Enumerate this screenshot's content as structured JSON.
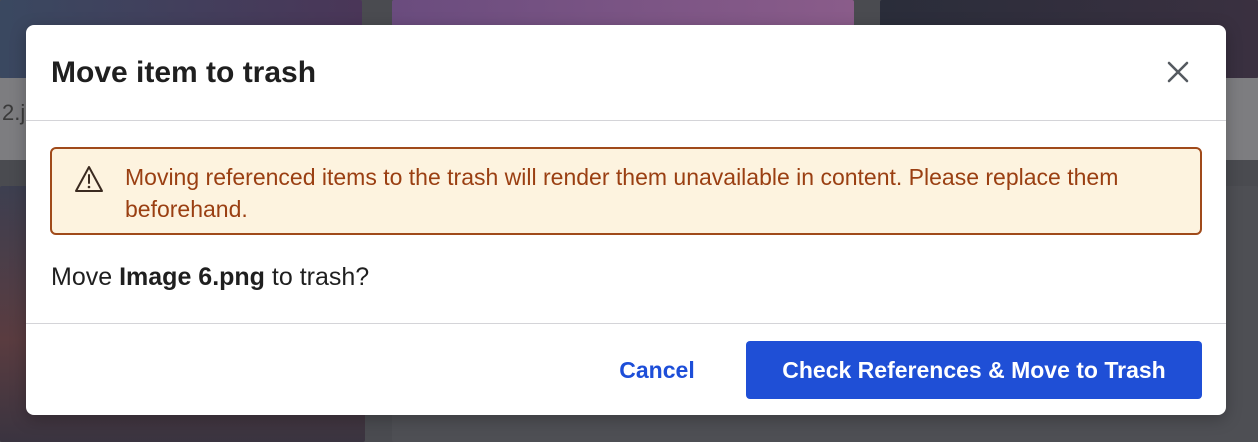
{
  "background": {
    "partial_filename": "2.j"
  },
  "dialog": {
    "title": "Move item to trash",
    "close_icon": "close-icon",
    "warning": {
      "icon": "warning-triangle-icon",
      "text": "Moving referenced items to the trash will render them unavailable in content. Please replace them beforehand."
    },
    "question": {
      "prefix": "Move ",
      "filename": "Image 6.png",
      "suffix": " to trash?"
    },
    "buttons": {
      "cancel_label": "Cancel",
      "confirm_label": "Check References & Move to Trash"
    }
  },
  "colors": {
    "primary": "#1f4fd6",
    "link": "#1d4ed8",
    "warning_bg": "#fdf3df",
    "warning_border": "#a04a1a",
    "warning_text": "#9a3f12"
  }
}
